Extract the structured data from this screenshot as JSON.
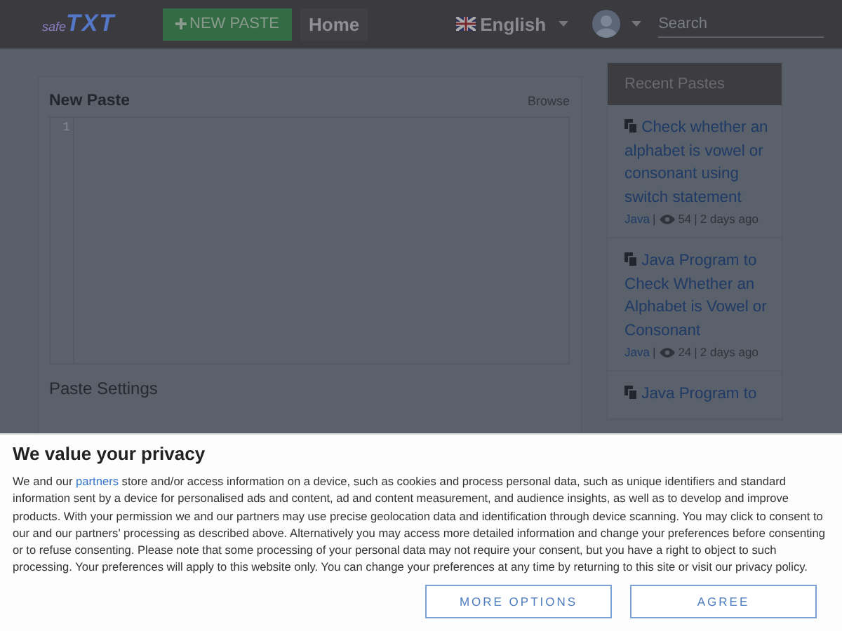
{
  "navbar": {
    "logo": {
      "prefix": "safe",
      "main": "TXT"
    },
    "new_paste": "NEW PASTE",
    "home": "Home",
    "language": "English",
    "search": {
      "placeholder": "Search"
    }
  },
  "paste_card": {
    "title": "New Paste",
    "browse": "Browse",
    "line_numbers": [
      "1"
    ],
    "settings_title": "Paste Settings"
  },
  "recent": {
    "title": "Recent Pastes",
    "items": [
      {
        "title": "Check whether an alphabet is vowel or consonant using switch statement",
        "language": "Java",
        "separator": "|",
        "views": "54",
        "time": "2 days ago"
      },
      {
        "title": "Java Program to Check Whether an Alphabet is Vowel or Consonant",
        "language": "Java",
        "separator": "|",
        "views": "24",
        "time": "2 days ago"
      },
      {
        "title": "Java Program to"
      }
    ]
  },
  "consent": {
    "title": "We value your privacy",
    "text_before": "We and our",
    "link": "partners",
    "text_after": "store and/or access information on a device, such as cookies and process personal data, such as unique identifiers and standard information sent by a device for personalised ads and content, ad and content measurement, and audience insights, as well as to develop and improve products. With your permission we and our partners may use precise geolocation data and identification through device scanning. You may click to consent to our and our partners’ processing as described above. Alternatively you may access more detailed information and change your preferences before consenting or to refuse consenting. Please note that some processing of your personal data may not require your consent, but you have a right to object to such processing. Your preferences will apply to this website only. You can change your preferences at any time by returning to this site or visit our privacy policy.",
    "buttons": [
      "MORE OPTIONS",
      "AGREE"
    ]
  }
}
